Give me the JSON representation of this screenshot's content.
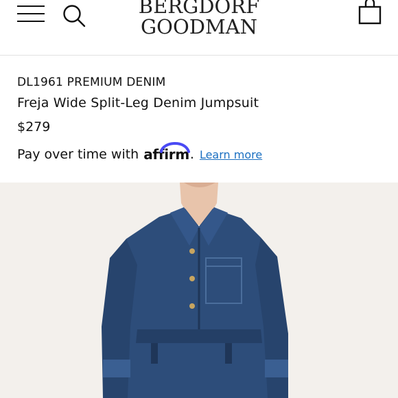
{
  "header": {
    "logo_line1": "BERGDORF",
    "logo_line2": "GOODMAN",
    "icons": {
      "menu": "hamburger-menu-icon",
      "search": "search-icon",
      "bag": "shopping-bag-icon"
    }
  },
  "product": {
    "brand": "DL1961 PREMIUM DENIM",
    "name": "Freja Wide Split-Leg Denim Jumpsuit",
    "price": "$279"
  },
  "financing": {
    "text": "Pay over time with",
    "provider": "affirm",
    "suffix": ".",
    "link": "Learn more",
    "link_color": "#1a6fc1"
  },
  "colors": {
    "denim": "#2d4d7a",
    "background": "#f3f0ec"
  }
}
